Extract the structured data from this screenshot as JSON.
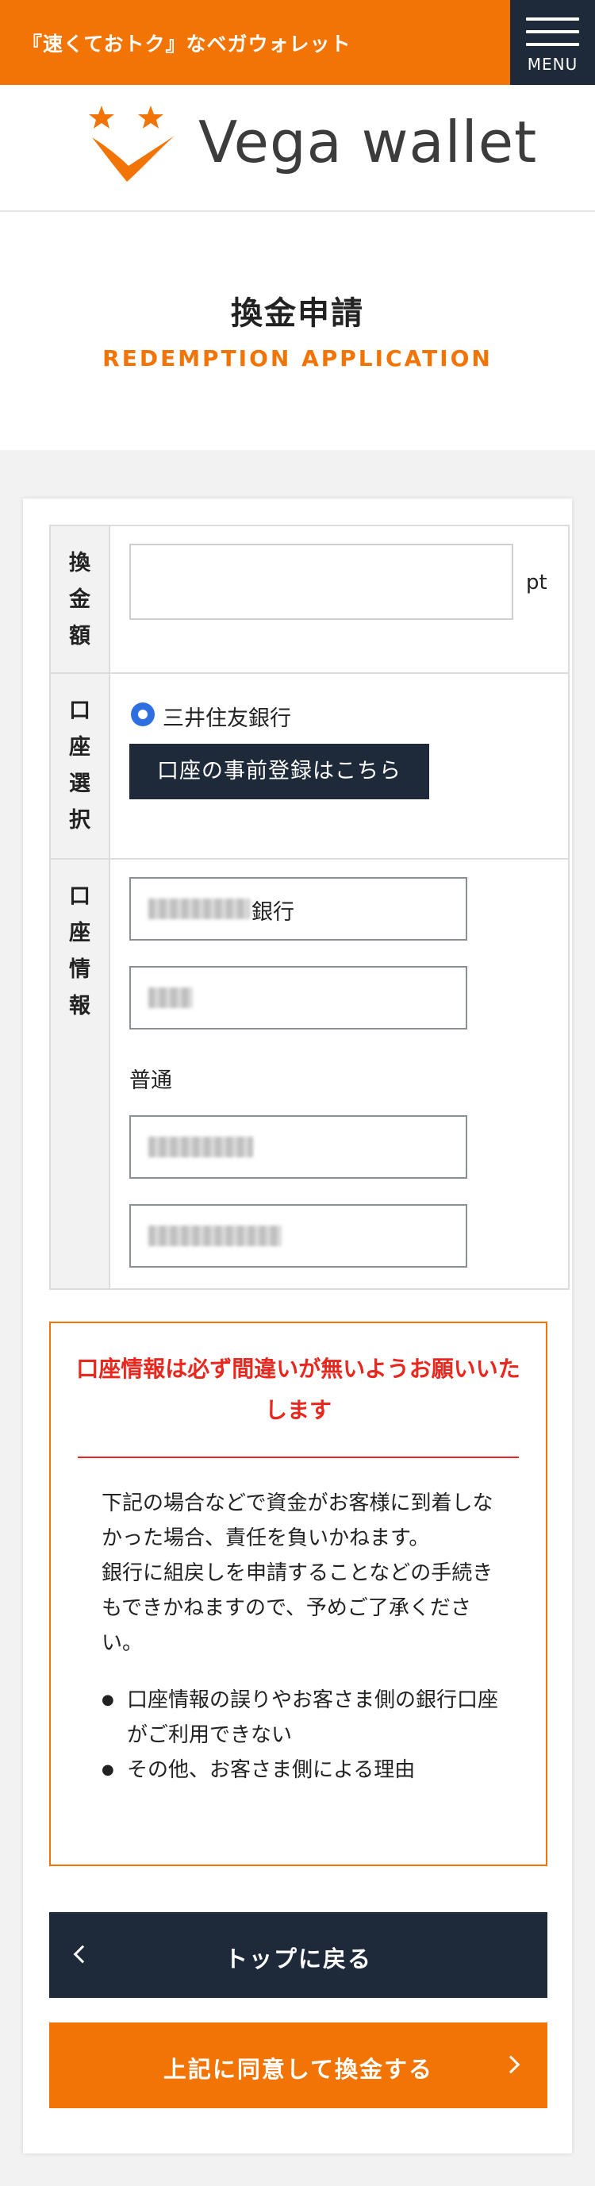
{
  "topbar": {
    "tagline": "『速くておトク』なベガウォレット",
    "menu_label": "MENU"
  },
  "header": {
    "logo_text": "Vega wallet"
  },
  "title": {
    "jp": "換金申請",
    "en": "REDEMPTION APPLICATION"
  },
  "form": {
    "amount": {
      "label": "換\n金\n額",
      "unit": "pt",
      "value": ""
    },
    "account": {
      "label": "口\n座\n選\n択",
      "radio_label": "三井住友銀行",
      "register_button": "口座の事前登録はこちら"
    },
    "info": {
      "label": "口\n座\n情\n報",
      "bank_suffix": "銀行",
      "account_type": "普通"
    }
  },
  "notice": {
    "title": "口座情報は必ず間違いが無いようお願いいたします",
    "body1": "下記の場合などで資金がお客様に到着しなかった場合、責任を負いかねます。",
    "body2": "銀行に組戻しを申請することなどの手続きもできかねますので、予めご了承ください。",
    "items": [
      "口座情報の誤りやお客さま側の銀行口座がご利用できない",
      "その他、お客さま側による理由"
    ]
  },
  "buttons": {
    "back": "トップに戻る",
    "agree": "上記に同意して換金する"
  },
  "colors": {
    "brand_orange": "#f27405",
    "navy": "#1e2a3a",
    "alert_red": "#e8281f",
    "radio_blue": "#2f6ee0"
  }
}
